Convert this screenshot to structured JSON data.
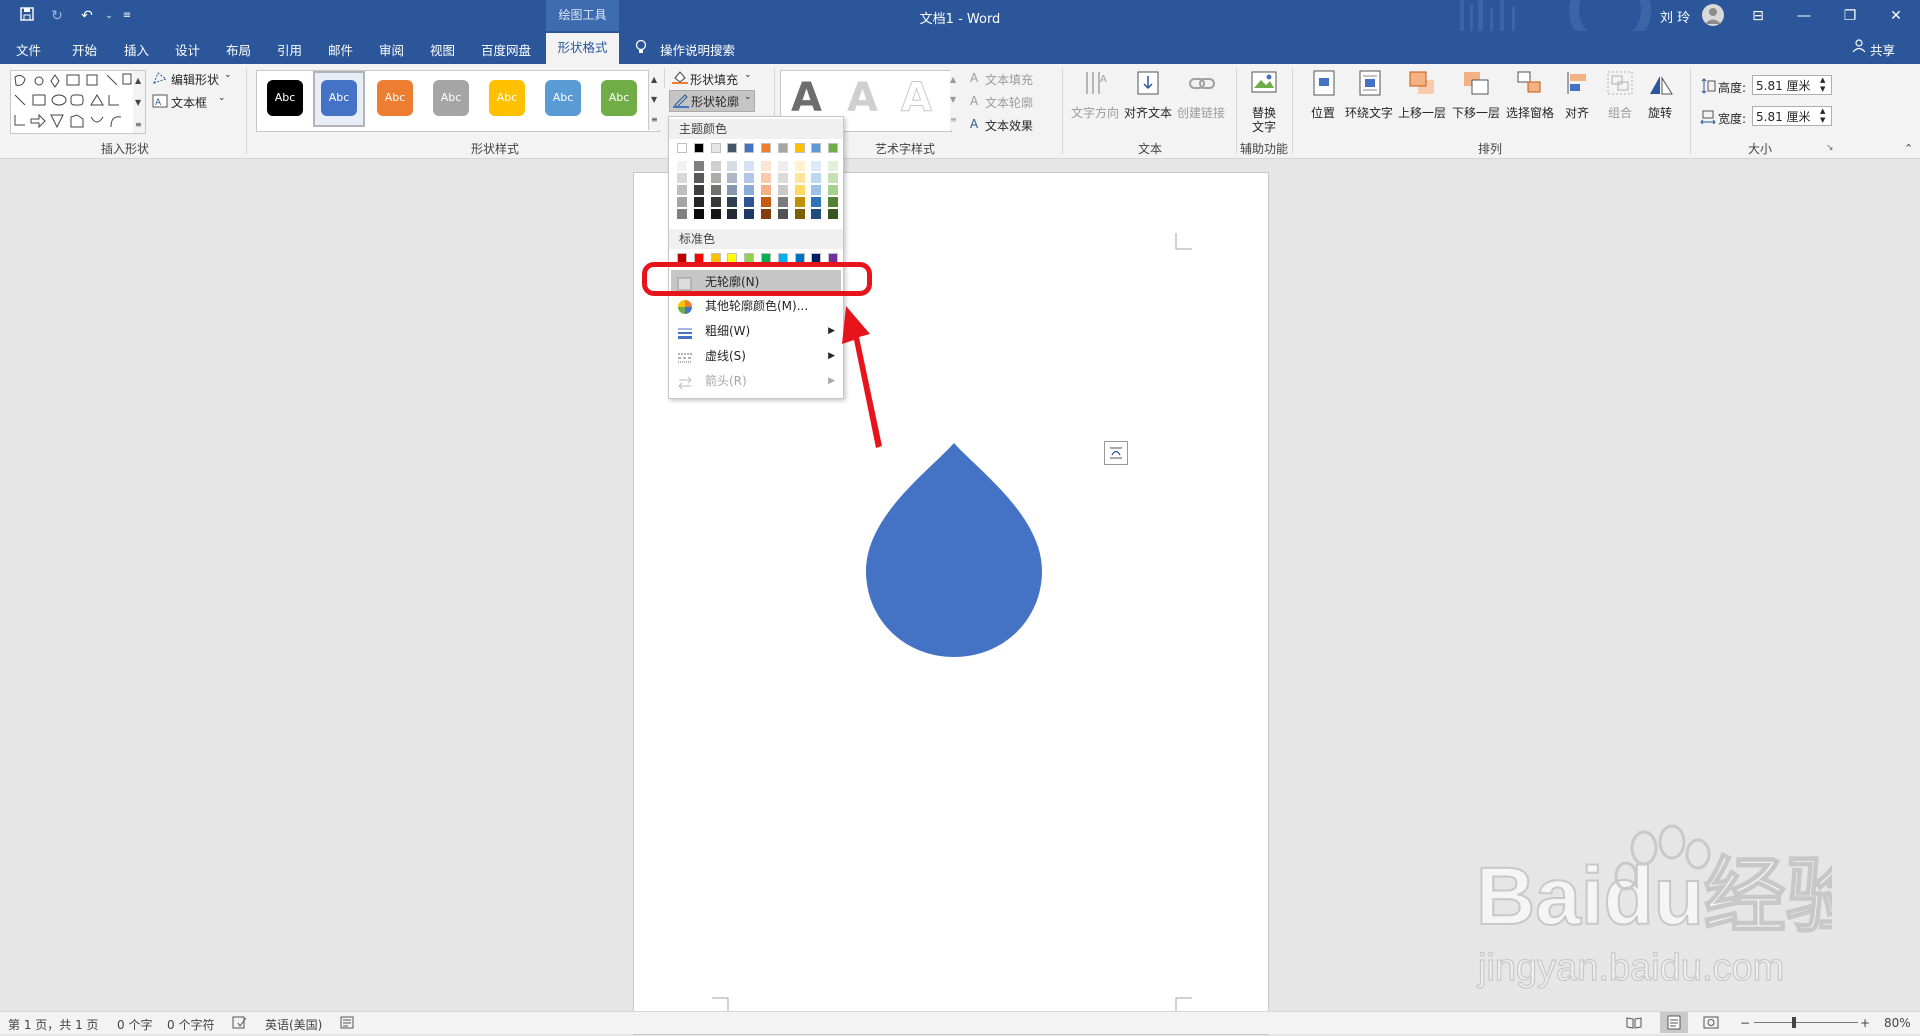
{
  "window": {
    "ctx_tab_group": "绘图工具",
    "doc_title": "文档1 - Word",
    "user": "刘 玲",
    "share": "共享"
  },
  "tabs": [
    "文件",
    "开始",
    "插入",
    "设计",
    "布局",
    "引用",
    "邮件",
    "审阅",
    "视图",
    "百度网盘",
    "形状格式"
  ],
  "search_tell": "操作说明搜索",
  "ribbon": {
    "insert_shapes": {
      "edit_shape": "编辑形状",
      "text_box": "文本框",
      "label": "插入形状"
    },
    "shape_styles": {
      "label": "形状样式",
      "abc": "Abc",
      "fill": "形状填充",
      "outline": "形状轮廓",
      "styles": [
        {
          "color": "#000000"
        },
        {
          "color": "#4472c4"
        },
        {
          "color": "#ed7d31"
        },
        {
          "color": "#a5a5a5"
        },
        {
          "color": "#ffc000"
        },
        {
          "color": "#5b9bd5"
        },
        {
          "color": "#70ad47"
        }
      ]
    },
    "wordart": {
      "label": "艺术字样式",
      "text_fill": "文本填充",
      "text_outline": "文本轮廓",
      "text_effect": "文本效果",
      "glyph": "A"
    },
    "text": {
      "label": "文本",
      "direction": "文字方向",
      "align": "对齐文本",
      "link": "创建链接"
    },
    "accessibility": {
      "label": "辅助功能",
      "alt_line1": "替换",
      "alt_line2": "文字"
    },
    "arrange": {
      "label": "排列",
      "position": "位置",
      "wrap": "环绕文字",
      "forward": "上移一层",
      "backward": "下移一层",
      "pane": "选择窗格",
      "align": "对齐",
      "group": "组合",
      "rotate": "旋转"
    },
    "size": {
      "label": "大小",
      "height_label": "高度:",
      "height_value": "5.81 厘米",
      "width_label": "宽度:",
      "width_value": "5.81 厘米"
    }
  },
  "outline_menu": {
    "theme_colors_head": "主题颜色",
    "theme_top_row": [
      "#ffffff",
      "#000000",
      "#e7e6e6",
      "#44546a",
      "#4472c4",
      "#ed7d31",
      "#a5a5a5",
      "#ffc000",
      "#5b9bd5",
      "#70ad47"
    ],
    "theme_shades": [
      [
        "#f2f2f2",
        "#7f7f7f",
        "#d0cece",
        "#d6dce4",
        "#d9e2f3",
        "#fbe5d5",
        "#ededed",
        "#fff2cc",
        "#deebf6",
        "#e2efd9"
      ],
      [
        "#d8d8d8",
        "#595959",
        "#aeabab",
        "#adb9ca",
        "#b4c6e7",
        "#f7cbac",
        "#dbdbdb",
        "#fee599",
        "#bdd7ee",
        "#c5e0b3"
      ],
      [
        "#bfbfbf",
        "#3f3f3f",
        "#757070",
        "#8496b0",
        "#8eaadb",
        "#f4b183",
        "#c9c9c9",
        "#ffd965",
        "#9cc3e5",
        "#a8d08d"
      ],
      [
        "#a5a5a5",
        "#262626",
        "#3a3838",
        "#323f4f",
        "#2f5496",
        "#c55a11",
        "#7b7b7b",
        "#bf9000",
        "#2e75b5",
        "#538135"
      ],
      [
        "#7f7f7f",
        "#0c0c0c",
        "#171616",
        "#222a35",
        "#1f3864",
        "#833c0b",
        "#525252",
        "#7f6000",
        "#1e4e79",
        "#375623"
      ]
    ],
    "standard_head": "标准色",
    "standard_colors": [
      "#c00000",
      "#ff0000",
      "#ffc000",
      "#ffff00",
      "#92d050",
      "#00b050",
      "#00b0f0",
      "#0070c0",
      "#002060",
      "#7030a0"
    ],
    "items": [
      {
        "label": "无轮廓(N)",
        "icon": "no-outline-icon",
        "enabled": true
      },
      {
        "label": "其他轮廓颜色(M)...",
        "icon": "color-wheel-icon",
        "enabled": true
      },
      {
        "label": "粗细(W)",
        "icon": "line-weight-icon",
        "enabled": true
      },
      {
        "label": "虚线(S)",
        "icon": "dashes-icon",
        "enabled": true
      },
      {
        "label": "箭头(R)",
        "icon": "arrows-icon",
        "enabled": false
      }
    ]
  },
  "annotation": {
    "highlight_color": "#e8141c"
  },
  "document": {
    "shape_color": "#4472c4"
  },
  "statusbar": {
    "page": "第 1 页，共 1 页",
    "words": "0 个字",
    "chars": "0 个字符",
    "language": "英语(美国)",
    "zoom": "80%"
  },
  "watermark": {
    "brand": "Baidu经验",
    "url": "jingyan.baidu.com"
  }
}
